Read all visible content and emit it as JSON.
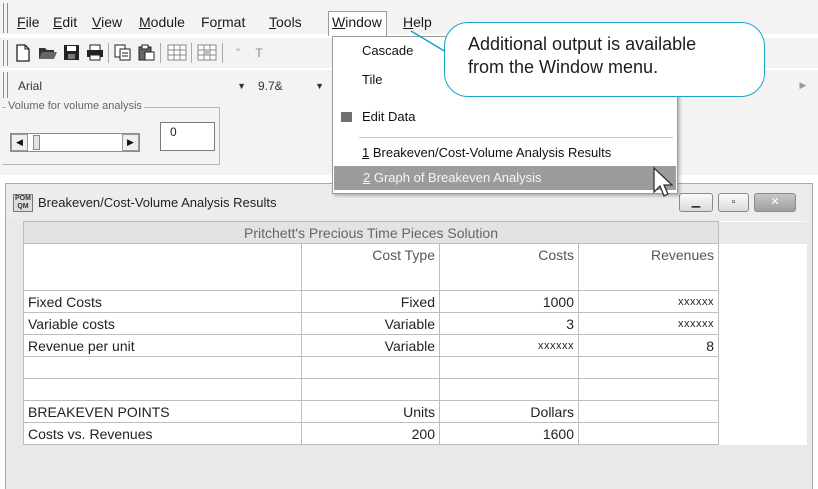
{
  "menubar": {
    "items": [
      {
        "pre": "",
        "u": "F",
        "post": "ile"
      },
      {
        "pre": "",
        "u": "E",
        "post": "dit"
      },
      {
        "pre": "",
        "u": "V",
        "post": "iew"
      },
      {
        "pre": "",
        "u": "M",
        "post": "odule"
      },
      {
        "pre": "Fo",
        "u": "r",
        "post": "mat"
      },
      {
        "pre": "",
        "u": "T",
        "post": "ools"
      },
      {
        "pre": "",
        "u": "W",
        "post": "indow"
      },
      {
        "pre": "",
        "u": "H",
        "post": "elp"
      }
    ]
  },
  "toolbar": {
    "icons": [
      "new-file-icon",
      "open-folder-icon",
      "save-icon",
      "print-icon",
      "copy-icon",
      "paste-icon",
      "grid-icon",
      "grid-format-icon",
      "column-icon",
      "text-icon"
    ],
    "truncated_glyph": "T"
  },
  "formatbar": {
    "font_name": "Arial",
    "font_size": "9.7&"
  },
  "volume": {
    "label": "Volume for volume analysis",
    "value": "0"
  },
  "window_menu": {
    "cascade": "Cascade",
    "tile": "Tile",
    "edit_data": "Edit Data",
    "item1_num": "1",
    "item1_text": " Breakeven/Cost-Volume Analysis Results",
    "item2_num": "2",
    "item2_text": " Graph of Breakeven Analysis"
  },
  "callout": {
    "line1": "Additional output is available",
    "line2": "from the Window menu."
  },
  "child_window": {
    "title": "Breakeven/Cost-Volume Analysis Results",
    "app_icon_text": "POM QM"
  },
  "results": {
    "table_title": "Pritchett's Precious Time Pieces Solution",
    "headers": [
      "",
      "Cost Type",
      "Costs",
      "Revenues"
    ],
    "rows": [
      [
        "Fixed Costs",
        "Fixed",
        "1000",
        "xxxxxx"
      ],
      [
        "Variable costs",
        "Variable",
        "3",
        "xxxxxx"
      ],
      [
        "Revenue per unit",
        "Variable",
        "xxxxxx",
        "8"
      ],
      [
        "",
        "",
        "",
        ""
      ],
      [
        "",
        "",
        "",
        ""
      ],
      [
        "BREAKEVEN POINTS",
        "Units",
        "Dollars",
        ""
      ],
      [
        "Costs vs. Revenues",
        "200",
        "1600",
        ""
      ]
    ]
  },
  "colors": {
    "callout_border": "#19a4c8",
    "menu_highlight": "#9c9c9c"
  }
}
